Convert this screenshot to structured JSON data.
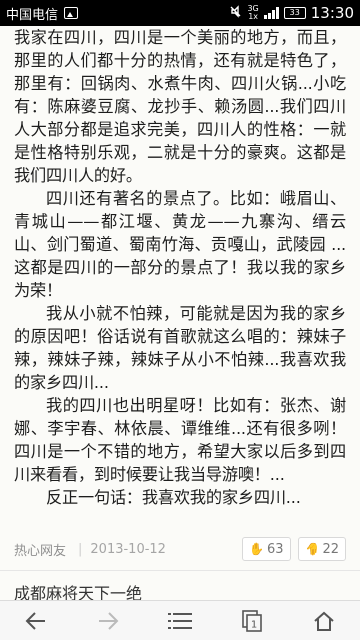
{
  "status_bar": {
    "carrier": "中国电信",
    "network_top": "3G",
    "network_bottom": "1x",
    "battery": "33",
    "time": "13:30"
  },
  "article": {
    "paragraphs": [
      {
        "indent": false,
        "text": "我家在四川，四川是一个美丽的地方，而且，那里的人们都十分的热情，还有就是特色了，那里有：回锅肉、水煮牛肉、四川火锅...小吃有：陈麻婆豆腐、龙抄手、赖汤圆...我们四川人大部分都是追求完美，四川人的性格：一就是性格特别乐观，二就是十分的豪爽。这都是我们四川人的好。"
      },
      {
        "indent": true,
        "text": "四川还有著名的景点了。比如：峨眉山、青城山——都江堰、黄龙——九寨沟、缙云山、剑门蜀道、蜀南竹海、贡嘎山，武陵园 ...这都是四川的一部分的景点了！我以我的家乡为荣！"
      },
      {
        "indent": true,
        "text": "我从小就不怕辣，可能就是因为我的家乡的原因吧！俗话说有首歌就这么唱的：辣妹子辣，辣妹子辣，辣妹子从小不怕辣...我喜欢我的家乡四川..."
      },
      {
        "indent": true,
        "text": "我的四川也出明星呀！比如有：张杰、谢娜、李宇春、林依晨、谭维维...还有很多咧！四川是一个不错的地方，希望大家以后多到四川来看看，到时候要让我当导游噢！..."
      },
      {
        "indent": true,
        "text": "反正一句话：我喜欢我的家乡四川..."
      }
    ]
  },
  "meta": {
    "author": "热心网友",
    "separator": "|",
    "date": "2013-10-12",
    "upvotes": "63",
    "downvotes": "22"
  },
  "next_item": {
    "title": "成都麻将天下一绝"
  },
  "bottom_nav": {
    "back_icon": "arrow-left-icon",
    "forward_icon": "arrow-right-icon",
    "menu_icon": "menu-icon",
    "tabs_count": "1",
    "home_icon": "home-icon"
  },
  "colors": {
    "accent": "#e48a2b",
    "down": "#9cc0d6",
    "status_bar_bg": "#000000"
  }
}
